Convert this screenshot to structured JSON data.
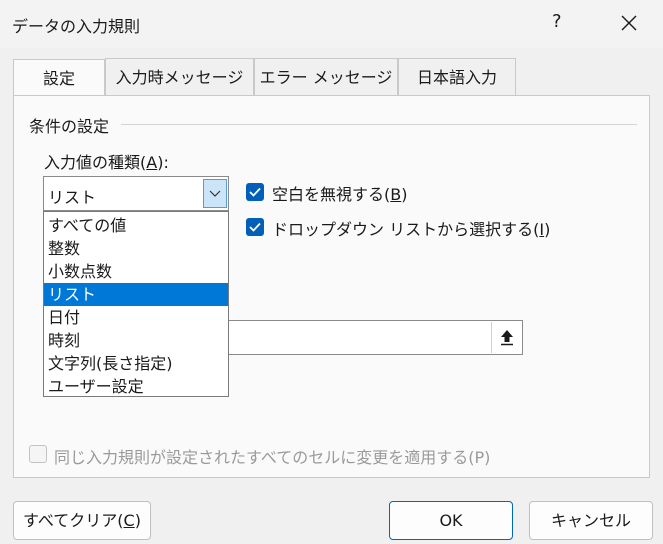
{
  "dialog": {
    "title": "データの入力規則",
    "help": "?"
  },
  "tabs": [
    {
      "label": "設定"
    },
    {
      "label": "入力時メッセージ"
    },
    {
      "label": "エラー メッセージ"
    },
    {
      "label": "日本語入力"
    }
  ],
  "conditions": {
    "title": "条件の設定",
    "type_label_pre": "入力値の種類(",
    "type_label_key": "A",
    "type_label_post": "):",
    "type_value": "リスト",
    "options": [
      "すべての値",
      "整数",
      "小数点数",
      "リスト",
      "日付",
      "時刻",
      "文字列(長さ指定)",
      "ユーザー設定"
    ],
    "selected_option": "リスト"
  },
  "checkboxes": {
    "ignore_blank": {
      "pre": "空白を無視する(",
      "key": "B",
      "post": ")",
      "checked": true
    },
    "dropdown": {
      "pre": "ドロップダウン リストから選択する(",
      "key": "I",
      "post": ")",
      "checked": true
    },
    "apply_all": {
      "text": "同じ入力規則が設定されたすべてのセルに変更を適用する(P)",
      "checked": false
    }
  },
  "buttons": {
    "clear": {
      "pre": "すべてクリア(",
      "key": "C",
      "post": ")"
    },
    "ok": "OK",
    "cancel": "キャンセル"
  },
  "colors": {
    "accent": "#005fb8",
    "selection": "#0078d7"
  }
}
